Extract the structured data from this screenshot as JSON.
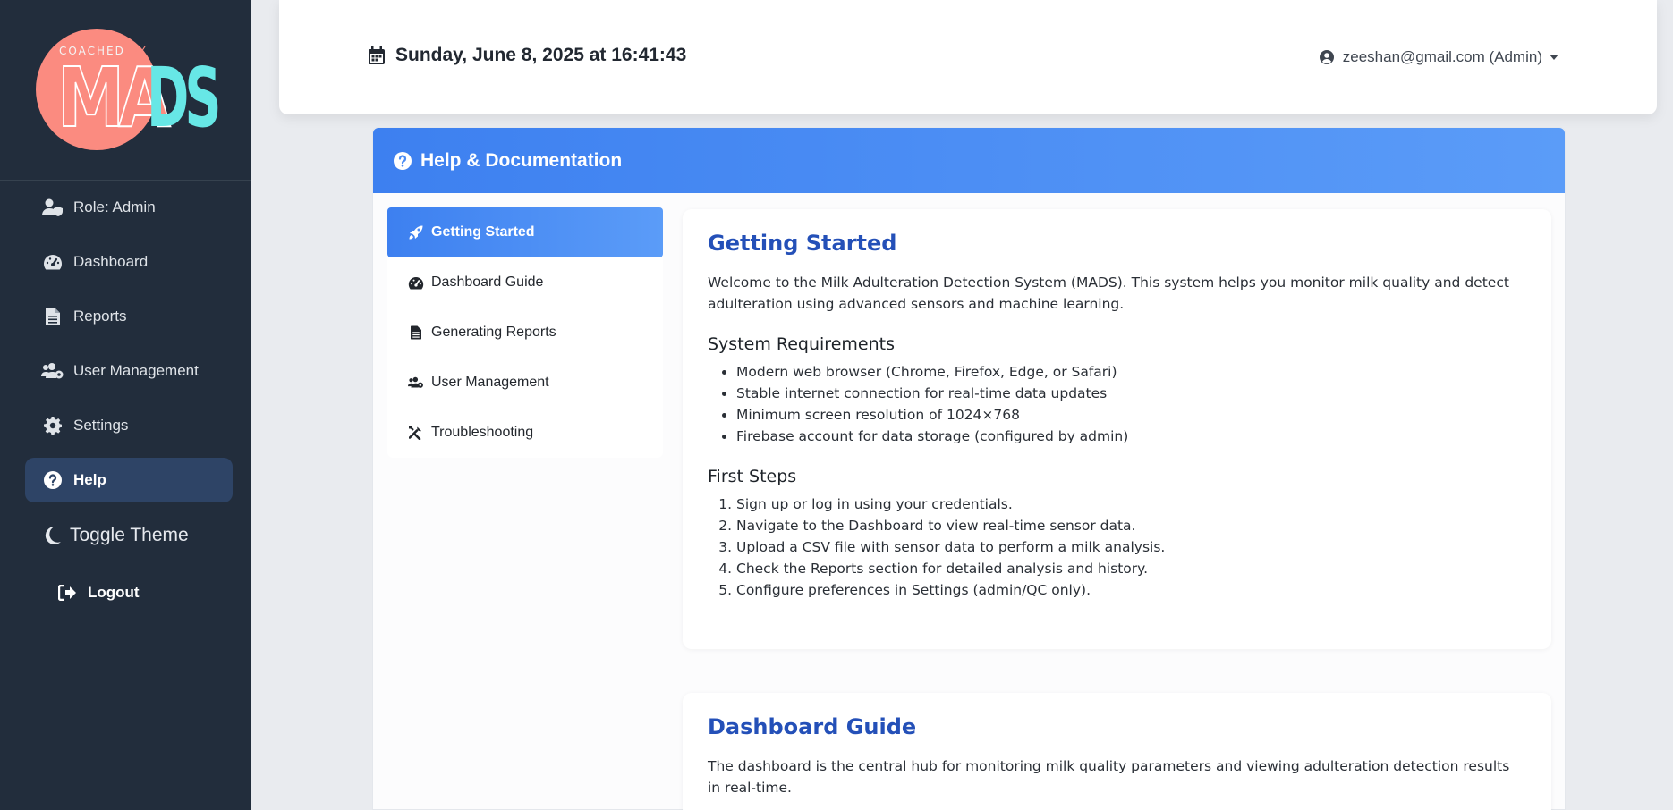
{
  "logo": {
    "coached_text": "COACHED",
    "by_text": "BY",
    "brand_left": "MA",
    "brand_right": "DS",
    "colors": {
      "circle": "#fb8b80",
      "accent": "#67e7e6"
    }
  },
  "sidebar": {
    "items": [
      {
        "label": "Role: Admin",
        "icon": "user-shield-icon"
      },
      {
        "label": "Dashboard",
        "icon": "gauge-icon"
      },
      {
        "label": "Reports",
        "icon": "file-icon"
      },
      {
        "label": "User Management",
        "icon": "users-cog-icon"
      },
      {
        "label": "Settings",
        "icon": "gear-icon"
      },
      {
        "label": "Help",
        "icon": "question-circle-icon",
        "active": true
      }
    ],
    "toggle_theme": "Toggle Theme",
    "logout": "Logout"
  },
  "header": {
    "date": "Sunday, June 8, 2025 at 16:41:43",
    "user": "zeeshan@gmail.com (Admin)"
  },
  "help": {
    "title": "Help & Documentation",
    "nav": [
      {
        "label": "Getting Started",
        "icon": "rocket-icon",
        "active": true
      },
      {
        "label": "Dashboard Guide",
        "icon": "gauge-icon"
      },
      {
        "label": "Generating Reports",
        "icon": "file-icon"
      },
      {
        "label": "User Management",
        "icon": "users-cog-icon"
      },
      {
        "label": "Troubleshooting",
        "icon": "tools-icon"
      }
    ],
    "getting_started": {
      "title": "Getting Started",
      "intro": "Welcome to the Milk Adulteration Detection System (MADS). This system helps you monitor milk quality and detect adulteration using advanced sensors and machine learning.",
      "requirements_title": "System Requirements",
      "requirements": [
        "Modern web browser (Chrome, Firefox, Edge, or Safari)",
        "Stable internet connection for real-time data updates",
        "Minimum screen resolution of 1024×768",
        "Firebase account for data storage (configured by admin)"
      ],
      "steps_title": "First Steps",
      "steps": [
        "Sign up or log in using your credentials.",
        "Navigate to the Dashboard to view real-time sensor data.",
        "Upload a CSV file with sensor data to perform a milk analysis.",
        "Check the Reports section for detailed analysis and history.",
        "Configure preferences in Settings (admin/QC only)."
      ]
    },
    "dashboard_guide": {
      "title": "Dashboard Guide",
      "intro": "The dashboard is the central hub for monitoring milk quality parameters and viewing adulteration detection results in real-time."
    }
  }
}
